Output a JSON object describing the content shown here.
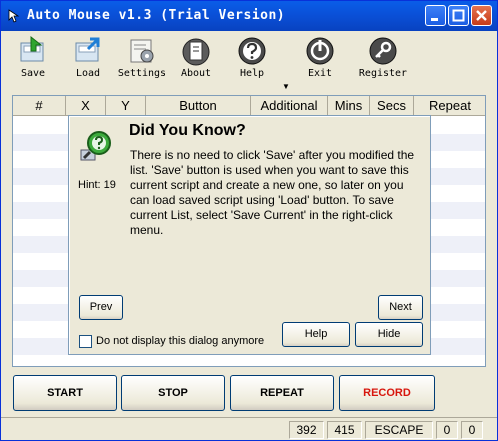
{
  "window": {
    "title": "Auto Mouse v1.3 (Trial Version)"
  },
  "toolbar": [
    {
      "label": "Save",
      "icon": "save-icon"
    },
    {
      "label": "Load",
      "icon": "load-icon"
    },
    {
      "label": "Settings",
      "icon": "settings-icon"
    },
    {
      "label": "About",
      "icon": "about-icon"
    },
    {
      "label": "Help",
      "icon": "help-icon"
    },
    {
      "label": "Exit",
      "icon": "exit-icon"
    },
    {
      "label": "Register",
      "icon": "register-icon"
    }
  ],
  "table": {
    "columns": [
      "#",
      "X",
      "Y",
      "Button",
      "Additional",
      "Mins",
      "Secs",
      "Repeat"
    ]
  },
  "dialog": {
    "title": "Did You Know?",
    "hint": "Hint: 19",
    "text": "There is no need to click 'Save' after you modified the list.  'Save' button is used when you want to save this current script and create a new one, so later on you can load saved script using 'Load' button.  To save current List, select 'Save Current' in the right-click menu.",
    "prev": "Prev",
    "next": "Next",
    "help": "Help",
    "hide": "Hide",
    "checkbox_label": "Do not display this dialog anymore"
  },
  "controls": {
    "start": "START",
    "stop": "STOP",
    "repeat": "REPEAT",
    "record": "RECORD"
  },
  "status": {
    "x": "392",
    "y": "415",
    "key": "ESCAPE",
    "c1": "0",
    "c2": "0"
  },
  "colors": {
    "titlebar": "#0a4fd6",
    "record_text": "#d7160d"
  }
}
